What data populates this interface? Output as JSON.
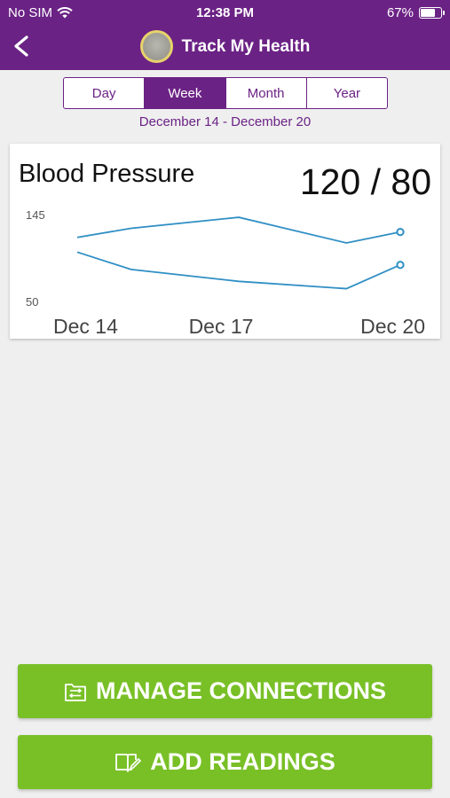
{
  "status_bar": {
    "carrier": "No SIM",
    "time": "12:38 PM",
    "battery": "67%"
  },
  "header": {
    "title": "Track My Health"
  },
  "period_tabs": [
    {
      "label": "Day",
      "active": false
    },
    {
      "label": "Week",
      "active": true
    },
    {
      "label": "Month",
      "active": false
    },
    {
      "label": "Year",
      "active": false
    }
  ],
  "date_range": "December 14 - December 20",
  "card": {
    "title": "Blood Pressure",
    "value": "120 / 80"
  },
  "chart_data": {
    "type": "line",
    "x": [
      "Dec 14",
      "Dec 15",
      "Dec 16",
      "Dec 17",
      "Dec 18",
      "Dec 19",
      "Dec 20"
    ],
    "x_tick_labels": [
      "Dec 14",
      "Dec 17",
      "Dec 20"
    ],
    "y_tick_labels": [
      "145",
      "50"
    ],
    "ylim": [
      50,
      145
    ],
    "series": [
      {
        "values": [
          120,
          130,
          null,
          142,
          null,
          114,
          126
        ]
      },
      {
        "values": [
          104,
          85,
          null,
          72,
          null,
          64,
          90
        ]
      }
    ],
    "color": "#2f8fc4",
    "grid": false
  },
  "buttons": {
    "manage": "MANAGE CONNECTIONS",
    "add": "ADD READINGS"
  }
}
